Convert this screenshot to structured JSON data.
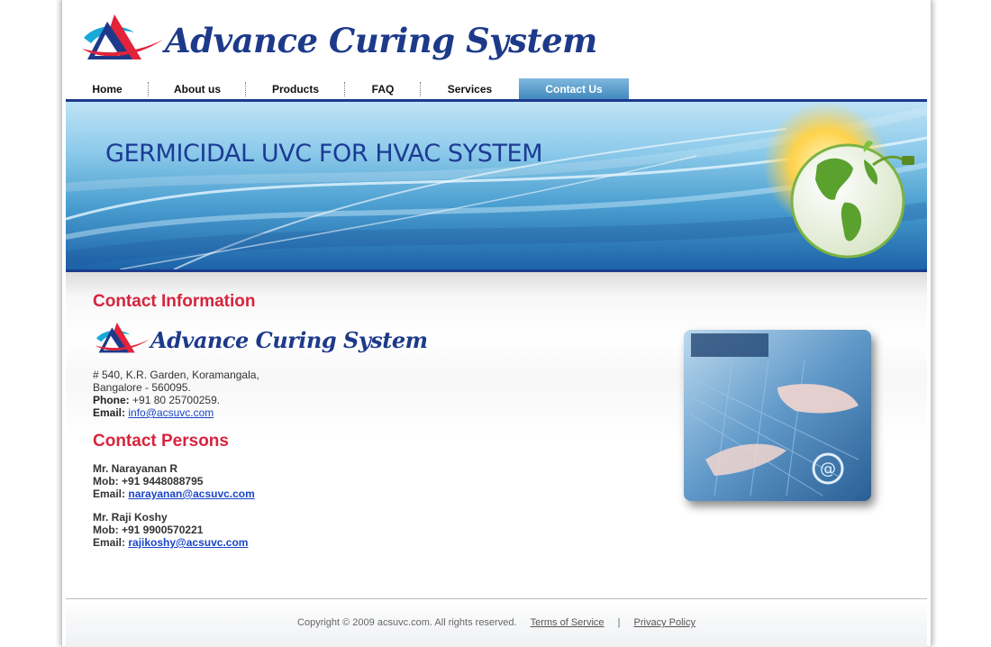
{
  "brand": {
    "name": "Advance Curing System"
  },
  "nav": {
    "items": [
      {
        "label": "Home"
      },
      {
        "label": "About us"
      },
      {
        "label": "Products"
      },
      {
        "label": "FAQ"
      },
      {
        "label": "Services"
      },
      {
        "label": "Contact Us"
      }
    ],
    "active": "Contact Us"
  },
  "banner": {
    "title": "GERMICIDAL UVC FOR HVAC SYSTEM"
  },
  "contact_info": {
    "heading": "Contact Information",
    "address_line1": "# 540, K.R. Garden, Koramangala,",
    "address_line2": "Bangalore - 560095.",
    "phone_label": "Phone:",
    "phone": "+91 80 25700259.",
    "email_label": "Email:",
    "email": "info@acsuvc.com"
  },
  "contact_persons": {
    "heading": "Contact Persons",
    "people": [
      {
        "name": "Mr. Narayanan R",
        "mob": "Mob: +91 9448088795",
        "email_label": "Email:",
        "email": "narayanan@acsuvc.com"
      },
      {
        "name": "Mr. Raji Koshy",
        "mob": "Mob: +91 9900570221",
        "email_label": "Email:",
        "email": "rajikoshy@acsuvc.com"
      }
    ]
  },
  "footer": {
    "copyright": "Copyright © 2009 acsuvc.com. All rights reserved.",
    "terms": "Terms of Service",
    "separator": "|",
    "privacy": "Privacy Policy"
  },
  "colors": {
    "brand_blue": "#1d3a8a",
    "heading_red": "#d7243e",
    "link_blue": "#1a45c9",
    "nav_active": "#4f93c6"
  },
  "icons": [
    "acs-logo-mark",
    "globe-icon",
    "laptop-typing-image"
  ]
}
